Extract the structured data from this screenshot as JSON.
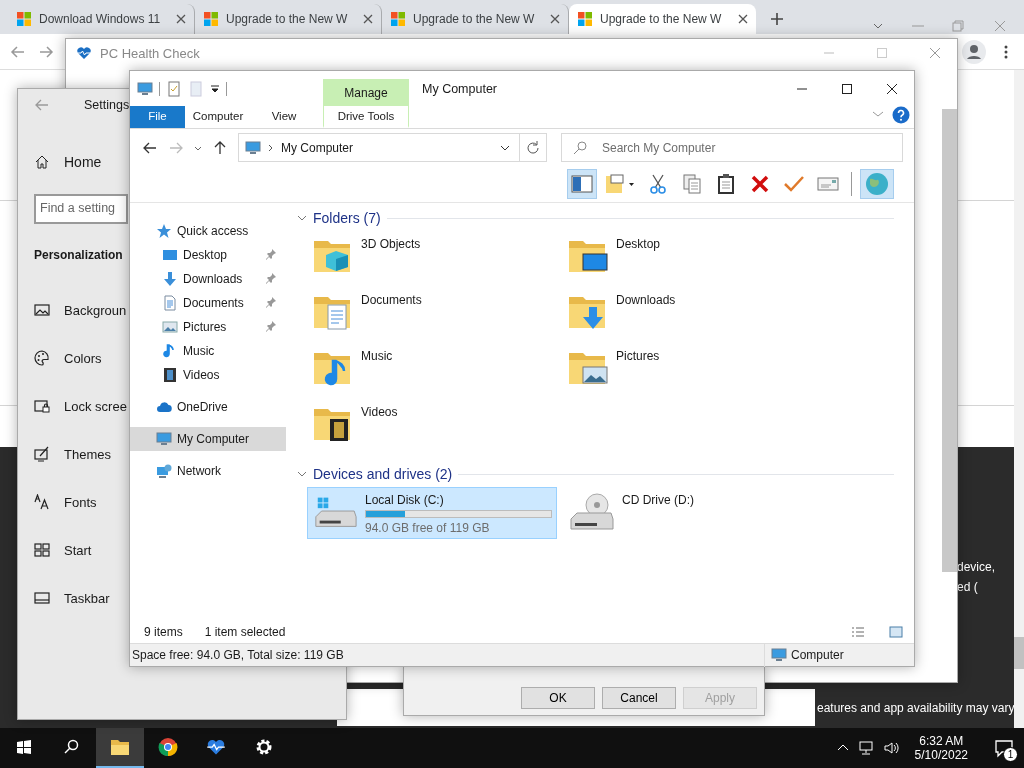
{
  "browser": {
    "tabs": [
      {
        "title": "Download Windows 11",
        "selected": false
      },
      {
        "title": "Upgrade to the New W",
        "selected": false
      },
      {
        "title": "Upgrade to the New W",
        "selected": false
      },
      {
        "title": "Upgrade to the New W",
        "selected": true
      }
    ]
  },
  "page": {
    "snippets": [
      "device,",
      "ed (",
      "eatures and app availability may vary"
    ]
  },
  "health_check": {
    "title": "PC Health Check"
  },
  "settings": {
    "title": "Settings",
    "home": "Home",
    "search": {
      "placeholder": "Find a setting"
    },
    "section": "Personalization",
    "items": [
      {
        "label": "Backgroun",
        "kind": "background"
      },
      {
        "label": "Colors",
        "kind": "colors"
      },
      {
        "label": "Lock scree",
        "kind": "lock"
      },
      {
        "label": "Themes",
        "kind": "themes"
      },
      {
        "label": "Fonts",
        "kind": "fonts"
      },
      {
        "label": "Start",
        "kind": "start"
      },
      {
        "label": "Taskbar",
        "kind": "taskbar"
      }
    ]
  },
  "dialog": {
    "buttons": [
      {
        "label": "OK",
        "disabled": false
      },
      {
        "label": "Cancel",
        "disabled": false
      },
      {
        "label": "Apply",
        "disabled": true
      }
    ]
  },
  "explorer": {
    "title": "My Computer",
    "context_header": "Manage",
    "ribbon_tabs": [
      {
        "label": "File",
        "kind": "file",
        "selected": false
      },
      {
        "label": "Computer",
        "kind": "tab",
        "selected": false
      },
      {
        "label": "View",
        "kind": "tab",
        "selected": false
      },
      {
        "label": "Drive Tools",
        "kind": "context",
        "selected": false
      }
    ],
    "address": "My Computer",
    "search": {
      "placeholder": "Search My Computer"
    },
    "toolbar": [
      {
        "kind": "pane",
        "selected": true
      },
      {
        "kind": "properties",
        "selected": false
      },
      {
        "kind": "cut",
        "selected": false
      },
      {
        "kind": "copy",
        "selected": false
      },
      {
        "kind": "paste",
        "selected": false
      },
      {
        "kind": "delete",
        "selected": false
      },
      {
        "kind": "check",
        "selected": false
      },
      {
        "kind": "rename",
        "selected": false
      },
      {
        "kind": "globe",
        "selected": true
      }
    ],
    "nav": [
      {
        "label": "Quick access",
        "kind": "star",
        "selected": false,
        "children": [
          {
            "label": "Desktop",
            "kind": "desktop",
            "pinned": true,
            "selected": false
          },
          {
            "label": "Downloads",
            "kind": "download",
            "pinned": true,
            "selected": false
          },
          {
            "label": "Documents",
            "kind": "documents",
            "pinned": true,
            "selected": false
          },
          {
            "label": "Pictures",
            "kind": "pictures",
            "pinned": true,
            "selected": false
          },
          {
            "label": "Music",
            "kind": "music",
            "pinned": false,
            "selected": false
          },
          {
            "label": "Videos",
            "kind": "videos",
            "pinned": false,
            "selected": false
          }
        ]
      },
      {
        "label": "OneDrive",
        "kind": "cloud",
        "selected": false
      },
      {
        "label": "My Computer",
        "kind": "computer",
        "selected": true
      },
      {
        "label": "Network",
        "kind": "network",
        "selected": false
      }
    ],
    "groups": [
      {
        "title": "Folders (7)",
        "expanded": true,
        "items": [
          {
            "label": "3D Objects",
            "kind": "objects",
            "selected": false
          },
          {
            "label": "Desktop",
            "kind": "desktop",
            "selected": false
          },
          {
            "label": "Documents",
            "kind": "documents",
            "selected": false
          },
          {
            "label": "Downloads",
            "kind": "download",
            "selected": false
          },
          {
            "label": "Music",
            "kind": "music",
            "selected": false
          },
          {
            "label": "Pictures",
            "kind": "pictures",
            "selected": false
          },
          {
            "label": "Videos",
            "kind": "videos",
            "selected": false
          }
        ]
      },
      {
        "title": "Devices and drives (2)",
        "expanded": true,
        "items": [
          {
            "label": "Local Disk (C:)",
            "kind": "disk",
            "level": 0.21,
            "free": "94.0 GB free of 119 GB",
            "selected": true
          },
          {
            "label": "CD Drive (D:)",
            "kind": "cd",
            "selected": false
          }
        ]
      }
    ],
    "status": {
      "count": "9 items",
      "selection": "1 item selected"
    },
    "details": {
      "summary": "Space free: 94.0 GB, Total size: 119 GB",
      "location": "Computer"
    }
  },
  "taskbar": {
    "time": "6:32 AM",
    "date": "5/10/2022",
    "notifications": "1"
  }
}
